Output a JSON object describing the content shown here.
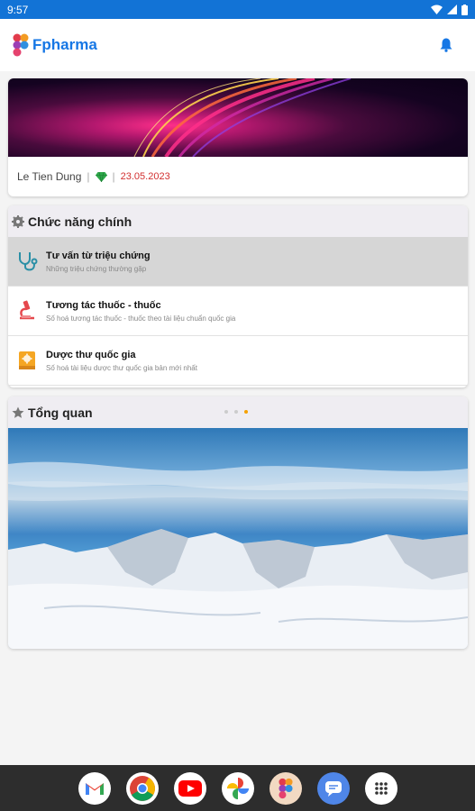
{
  "status_bar": {
    "time": "9:57"
  },
  "app_bar": {
    "title": "Fpharma"
  },
  "profile": {
    "name": "Le Tien Dung",
    "separator": "|",
    "date": "23.05.2023"
  },
  "functions": {
    "title": "Chức năng chính",
    "items": [
      {
        "title": "Tư vấn từ triệu chứng",
        "subtitle": "Những triệu chứng thường gặp"
      },
      {
        "title": "Tương tác thuốc - thuốc",
        "subtitle": "Số hoá tương tác thuốc - thuốc theo tài liệu chuẩn quốc gia"
      },
      {
        "title": "Dược thư quốc gia",
        "subtitle": "Số hoá tài liệu dược thư quốc gia bản mới nhất"
      }
    ]
  },
  "overview": {
    "title": "Tổng quan",
    "carousel_active_index": 2
  },
  "colors": {
    "brand": "#1677e5",
    "status_bar": "#1273d6",
    "date": "#d23030",
    "dot_active": "#f5a100"
  },
  "dock": [
    "gmail-icon",
    "chrome-icon",
    "youtube-icon",
    "photos-icon",
    "fpharma-icon",
    "messages-icon",
    "apps-icon"
  ]
}
